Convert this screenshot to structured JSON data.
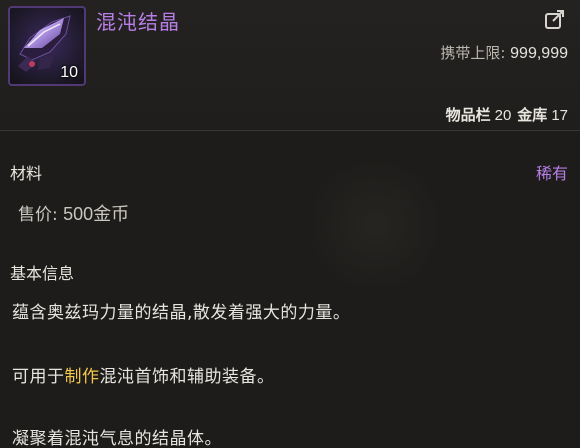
{
  "item": {
    "name": "混沌结晶",
    "stack_count": "10",
    "icon": "chaos-crystal-icon",
    "name_color": "#b67ee6"
  },
  "header": {
    "carry_limit_label": "携带上限:",
    "carry_limit_value": "999,999",
    "inventory_label": "物品栏",
    "inventory_count": "20",
    "vault_label": "金库",
    "vault_count": "17",
    "share_icon": "share-icon"
  },
  "details": {
    "type": "材料",
    "rarity": "稀有",
    "rarity_color": "#b67ee6",
    "price_label": "售价:",
    "price_value": "500金币"
  },
  "info": {
    "section_title": "基本信息",
    "line1": "蕴含奥兹玛力量的结晶,散发着强大的力量。",
    "line2_prefix": "可用于",
    "line2_highlight": "制作",
    "line2_suffix": "混沌首饰和辅助装备。",
    "line3": "凝聚着混沌气息的结晶体。",
    "highlight_color": "#f2c84a"
  }
}
